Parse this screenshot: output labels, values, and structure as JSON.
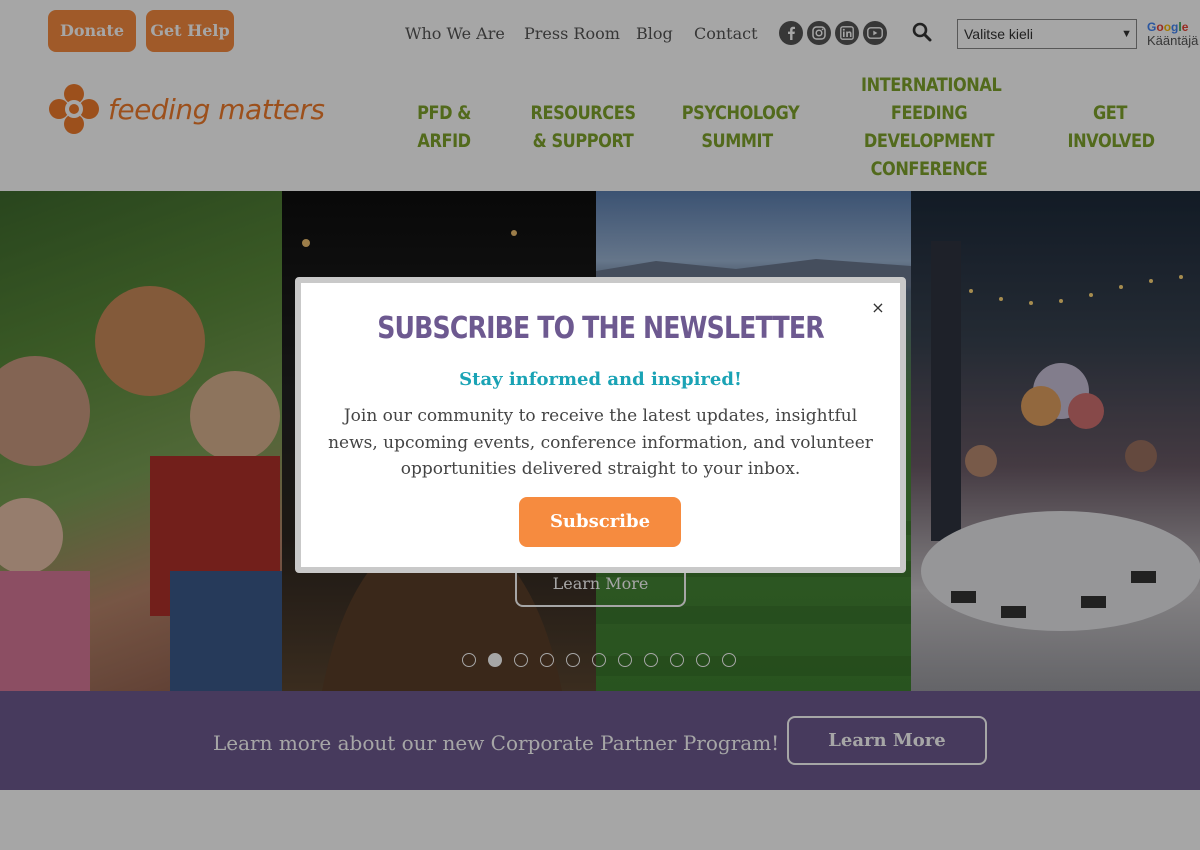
{
  "topbar": {
    "donate_label": "Donate",
    "help_label": "Get Help",
    "links": [
      "Who We Are",
      "Press Room",
      "Blog",
      "Contact"
    ],
    "social_icons": [
      "facebook-icon",
      "instagram-icon",
      "linkedin-icon",
      "youtube-icon"
    ],
    "language_select": "Valitse kieli",
    "google_label": "Google",
    "translate_label": "Kääntäjä"
  },
  "header": {
    "logo_text": "feeding matters",
    "nav": [
      {
        "label": "PFD &\nARFID"
      },
      {
        "label": "RESOURCES\n& SUPPORT"
      },
      {
        "label": "PSYCHOLOGY\nSUMMIT"
      },
      {
        "label": "INTERNATIONAL\nFEEDING\nDEVELOPMENT\nCONFERENCE"
      },
      {
        "label": "GET\nINVOLVED"
      }
    ]
  },
  "hero": {
    "learn_more_label": "Learn More",
    "dot_count": 11,
    "active_dot": 1
  },
  "band": {
    "text": "Learn more about our new Corporate Partner Program!",
    "button_label": "Learn More"
  },
  "modal": {
    "title": "SUBSCRIBE TO THE NEWSLETTER",
    "subtitle": "Stay informed and inspired!",
    "body": "Join our community to receive the latest updates, insightful news, upcoming events, conference information, and volunteer opportunities delivered straight to your inbox.",
    "button_label": "Subscribe",
    "close_glyph": "×"
  },
  "colors": {
    "orange": "#f68b3f",
    "green": "#7fa32b",
    "purple": "#6d5990",
    "teal": "#1aa3b5"
  }
}
